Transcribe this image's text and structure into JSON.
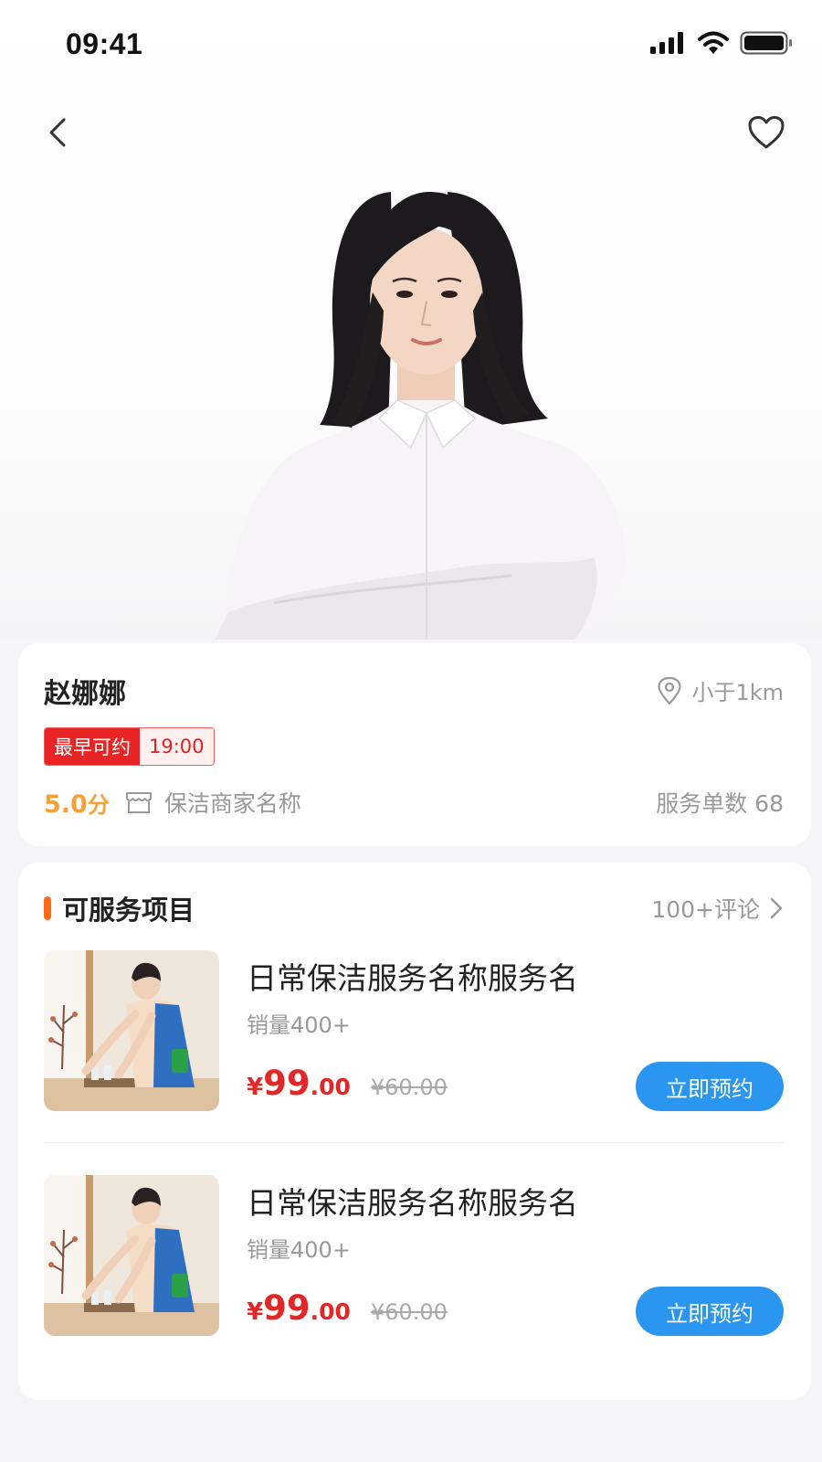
{
  "status_bar": {
    "time": "09:41"
  },
  "icons": {
    "back": "chevron-left-icon",
    "favorite": "heart-outline-icon",
    "location": "location-pin-icon",
    "store": "store-icon",
    "chevron": "chevron-right-icon"
  },
  "colors": {
    "accent_blue": "#2b96f0",
    "price_red": "#e02828",
    "tag_red": "#e82424",
    "rating_orange": "#f5a134",
    "section_bar": "#ff6a1a"
  },
  "profile": {
    "name": "赵娜娜",
    "distance": "小于1km",
    "earliest_label": "最早可约",
    "earliest_time": "19:00",
    "rating": "5.0",
    "rating_unit": "分",
    "merchant": "保洁商家名称",
    "orders": "服务单数 68"
  },
  "services": {
    "title": "可服务项目",
    "reviews_link": "100+评论",
    "items": [
      {
        "name": "日常保洁服务名称服务名",
        "sales": "销量400+",
        "currency": "¥",
        "price_int": "99",
        "price_dec": ".00",
        "original_price": "¥60.00",
        "button": "立即预约"
      },
      {
        "name": "日常保洁服务名称服务名",
        "sales": "销量400+",
        "currency": "¥",
        "price_int": "99",
        "price_dec": ".00",
        "original_price": "¥60.00",
        "button": "立即预约"
      }
    ]
  }
}
